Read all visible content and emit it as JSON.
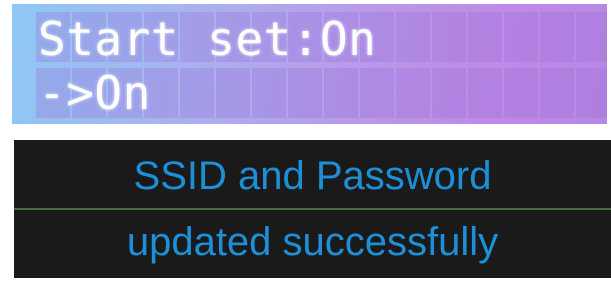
{
  "lcd_screen": {
    "line1": "Start set:On",
    "line2": "->On",
    "text_color": "#ffffff",
    "backlight_colors": [
      "#8ec8f4",
      "#c08ae6"
    ]
  },
  "oled_screen": {
    "line1": "SSID and Password",
    "line2": "updated successfully",
    "text_color": "#1e8fd6",
    "background_color": "#1a1a1a"
  }
}
